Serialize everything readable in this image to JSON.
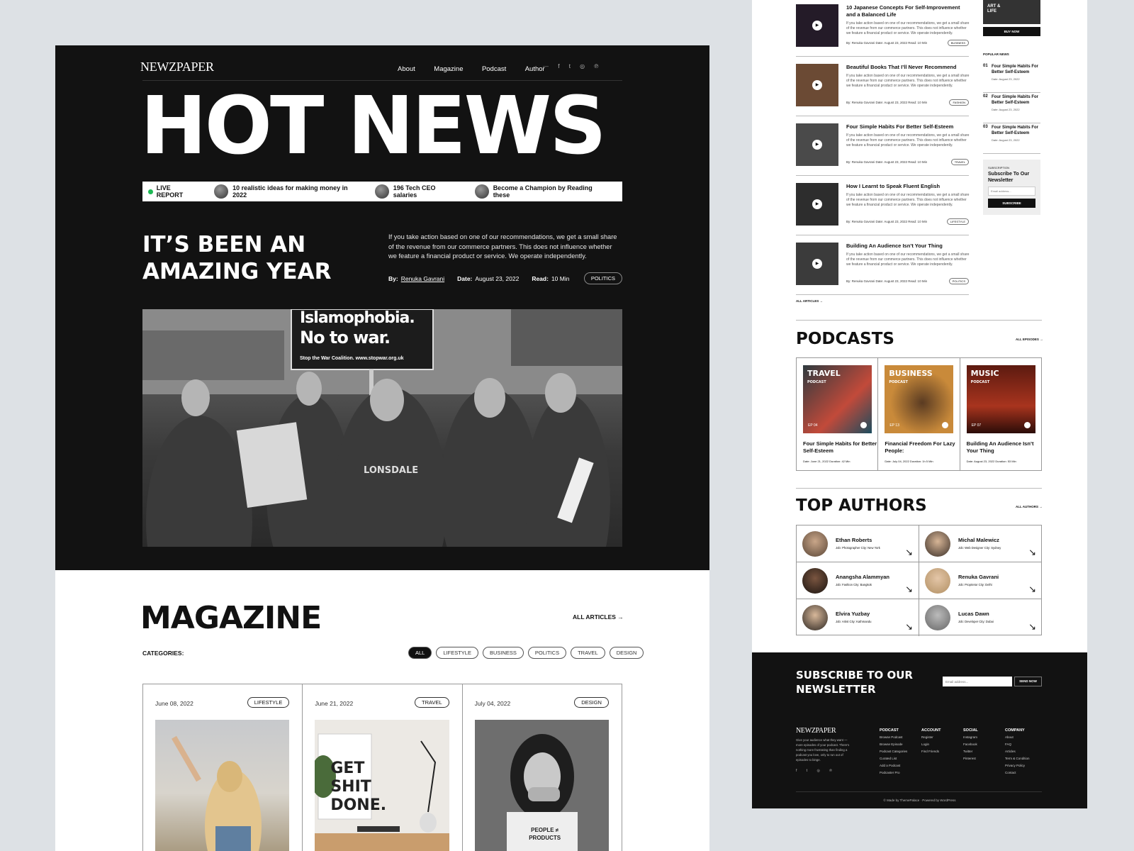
{
  "brand": "NEWZPAPER",
  "nav": {
    "items": [
      "About",
      "Magazine",
      "Podcast",
      "Author"
    ],
    "social": [
      "f",
      "t",
      "◎",
      "℗"
    ]
  },
  "hero": {
    "headline": "HOT NEWS",
    "ticker": [
      {
        "label": "LIVE REPORT"
      },
      {
        "label": "10 realistic ideas for making money in 2022"
      },
      {
        "label": "196 Tech CEO salaries"
      },
      {
        "label": "Become a Champion by Reading these"
      }
    ],
    "title": "IT’S BEEN AN AMAZING YEAR",
    "intro": "If you take action based on one of our recommendations, we get a small share of the revenue from our commerce partners. This does not influence whether we feature a financial product or service. We operate independently.",
    "by_label": "By:",
    "author": "Renuka Gavrani",
    "date_label": "Date:",
    "date": "August 23, 2022",
    "read_label": "Read:",
    "read": "10 Min",
    "tag": "POLITICS",
    "image_sign1": "Islamophobia.",
    "image_sign2": "No to war.",
    "image_sign3": "Stop the War Coalition. www.stopwar.org.uk",
    "image_shirt": "LONSDALE"
  },
  "magazine": {
    "title": "MAGAZINE",
    "all_articles": "ALL ARTICLES",
    "categories_label": "CATEGORIES:",
    "categories": [
      "ALL",
      "LIFESTYLE",
      "BUSINESS",
      "POLITICS",
      "TRAVEL",
      "DESIGN"
    ],
    "cards": [
      {
        "date": "June 08, 2022",
        "tag": "LIFESTYLE"
      },
      {
        "date": "June 21, 2022",
        "tag": "TRAVEL",
        "poster": "GET SHIT DONE."
      },
      {
        "date": "July 04, 2022",
        "tag": "DESIGN",
        "shirt": "PEOPLE ≠ PRODUCTS"
      }
    ]
  },
  "right": {
    "ad_text": "ART & LIFE",
    "ad_button": "BUY NOW",
    "articles": [
      {
        "title": "10 Japanese Concepts For Self-Improvement and a Balanced Life",
        "tag": "BUSINESS"
      },
      {
        "title": "Beautiful Books That I’ll Never Recommend",
        "tag": "FASHION"
      },
      {
        "title": "Four Simple Habits For Better Self-Esteem",
        "tag": "TRAVEL"
      },
      {
        "title": "How I Learnt to Speak Fluent English",
        "tag": "LIFESTYLE"
      },
      {
        "title": "Building An Audience Isn’t Your Thing",
        "tag": "POLITICS"
      }
    ],
    "article_text": "If you take action based on one of our recommendations, we get a small share of the revenue from our commerce partners. This does not influence whether we feature a financial product or service. We operate independently.",
    "article_meta": "By: Renuka Gavrani    Date: August 23, 2022    Read: 10 Min",
    "all_articles": "ALL ARTICLES →",
    "popular_label": "POPULAR NEWS",
    "popular": [
      {
        "num": "01",
        "title": "Four Simple Habits For Better Self-Esteem",
        "date": "Date: August 23, 2022"
      },
      {
        "num": "02",
        "title": "Four Simple Habits For Better Self-Esteem",
        "date": "Date: August 23, 2022"
      },
      {
        "num": "03",
        "title": "Four Simple Habits For Better Self-Esteem",
        "date": "Date: August 23, 2022"
      }
    ],
    "sub_small": "SUBSCRIPTION",
    "sub_title": "Subscribe To Our Newsletter",
    "sub_placeholder": "Email address...",
    "sub_button": "SUBSCRIBE",
    "podcasts_title": "PODCASTS",
    "all_episodes": "ALL EPISODES →",
    "podcasts": [
      {
        "cat": "TRAVEL",
        "sub": "PODCAST",
        "ep": "EP 04",
        "title": "Four Simple Habits for Better Self-Esteem",
        "meta": "Date: June 21, 2022   Duration: 42 Min",
        "color": "#4a6a6a"
      },
      {
        "cat": "BUSINESS",
        "sub": "PODCAST",
        "ep": "EP 13",
        "title": "Financial Freedom For Lazy People:",
        "meta": "Date: July 04, 2022   Duration: 1h 5 Min",
        "color": "#c98a3a"
      },
      {
        "cat": "MUSIC",
        "sub": "PODCAST",
        "ep": "EP 07",
        "title": "Building An Audience Isn’t Your Thing",
        "meta": "Date: August 23, 2022   Duration: 53 Min",
        "color": "#7a2a1e"
      }
    ],
    "authors_title": "TOP AUTHORS",
    "all_authors": "ALL AUTHORS →",
    "authors": [
      {
        "name": "Ethan Roberts",
        "meta": "Job: Photographer   City: New York"
      },
      {
        "name": "Michal Malewicz",
        "meta": "Job: Web Designer   City: Sydney"
      },
      {
        "name": "Anangsha Alammyan",
        "meta": "Job: Fashion   City: Bangkok"
      },
      {
        "name": "Renuka Gavrani",
        "meta": "Job: Proprietor   City: Delhi"
      },
      {
        "name": "Elvira Yuzbay",
        "meta": "Job: Artist   City: Kathmandu"
      },
      {
        "name": "Lucas Dawn",
        "meta": "Job: Developer   City: Dubai"
      }
    ],
    "footer": {
      "newsletter": "SUBSCRIBE TO OUR NEWSLETTER",
      "placeholder": "Email address...",
      "send": "SEND NOW",
      "brand": "NEWZPAPER",
      "about": "Give your audience what they want — more episodes of your podcast. There's nothing more frustrating than finding a podcast you love, only to run out of episodes to binge.",
      "cols": [
        {
          "head": "PODCAST",
          "items": [
            "Browse Podcast",
            "Browse Episode",
            "Podcast Categories",
            "Curated List",
            "Add a Podcast",
            "Podcaster Pro"
          ]
        },
        {
          "head": "ACCOUNT",
          "items": [
            "Register",
            "Login",
            "Find Friends"
          ]
        },
        {
          "head": "SOCIAL",
          "items": [
            "Instagram",
            "Facebook",
            "Twitter",
            "Pinterest"
          ]
        },
        {
          "head": "COMPANY",
          "items": [
            "About",
            "FAQ",
            "Articles",
            "Term & Condition",
            "Privacy Policy",
            "Contact"
          ]
        }
      ],
      "credit": "© Made by ThemePalace · Powered by WordPress"
    }
  }
}
